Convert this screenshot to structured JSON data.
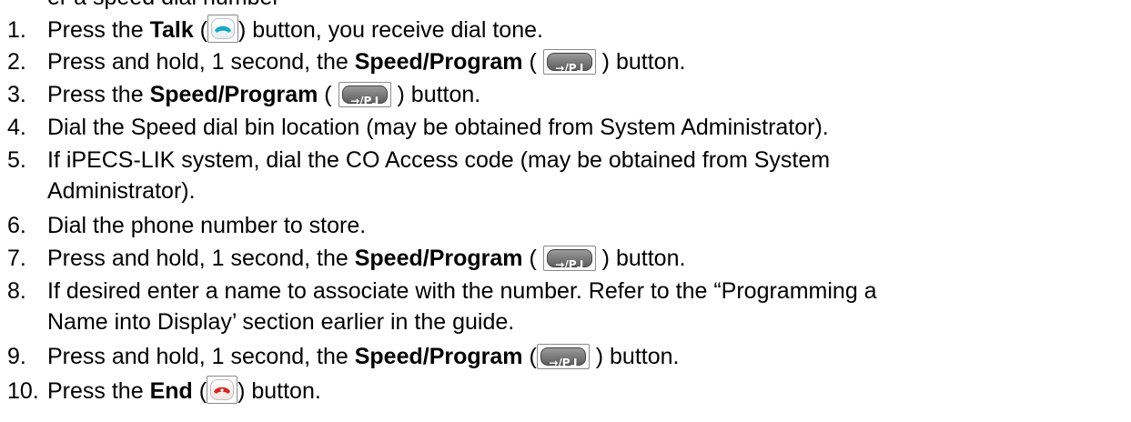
{
  "top_fragment": "er a speed dial number",
  "steps": [
    {
      "num": "1.",
      "pre": "Press the ",
      "bold": "Talk",
      "post": " button, you receive dial tone.",
      "icon": "talk-handset-icon"
    },
    {
      "num": "2.",
      "pre": "Press and hold, 1 second, the ",
      "bold": "Speed/Program",
      "post": " button.",
      "icon": "speed-program-key"
    },
    {
      "num": "3.",
      "pre": "Press the ",
      "bold": "Speed/Program",
      "post": " button.",
      "icon": "speed-program-key"
    },
    {
      "num": "4.",
      "text": "Dial the Speed dial bin location (may be obtained from System Administrator)."
    },
    {
      "num": "5.",
      "text": "If iPECS-LIK system, dial the CO Access code (may be obtained from System",
      "cont": "Administrator)."
    },
    {
      "num": "6.",
      "text": "Dial the phone number to store."
    },
    {
      "num": "7.",
      "pre": "Press and hold, 1 second, the ",
      "bold": "Speed/Program",
      "post": " button.",
      "icon": "speed-program-key"
    },
    {
      "num": "8.",
      "text": "If desired enter a name to associate with the number.  Refer to the “Programming a",
      "cont": "Name into Display’ section earlier in the guide."
    },
    {
      "num": "9.",
      "pre": "Press and hold, 1 second, the ",
      "bold": "Speed/Program",
      "post": " button.",
      "icon": "speed-program-key"
    },
    {
      "num": "10.",
      "pre": "Press the ",
      "bold": "End",
      "post": " button.",
      "icon": "end-handset-icon"
    }
  ],
  "key_label": "→/P⅃",
  "colors": {
    "talk": "#18a8c8",
    "end": "#d2281e",
    "speed_key": "#6e6e6e"
  }
}
